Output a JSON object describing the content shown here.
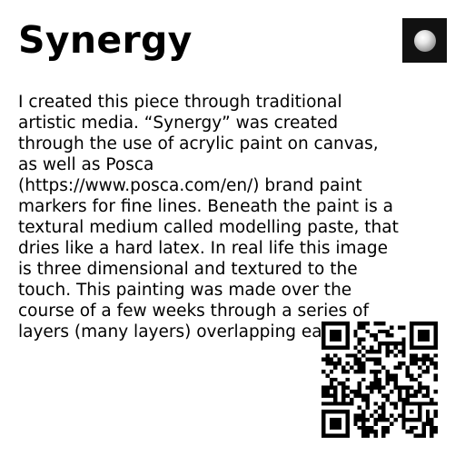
{
  "artwork": {
    "title": "Synergy",
    "description": "I created this piece through traditional artistic media. “Synergy” was created through the use of acrylic paint on canvas, as well as Posca (https://www.posca.com/en/) brand paint markers for fine lines. Beneath the paint is a textural medium called modelling paste, that dries like a hard latex. In real life this image is three dimensional and textured to the touch. This painting was made over the course of a few weeks through a series of layers (many layers) overlapping each other."
  },
  "icons": {
    "thumbnail": "artwork-thumbnail-icon",
    "qr": "qr-code-icon"
  },
  "colors": {
    "text": "#000000",
    "background": "#ffffff",
    "thumbnail_bg": "#111111"
  }
}
